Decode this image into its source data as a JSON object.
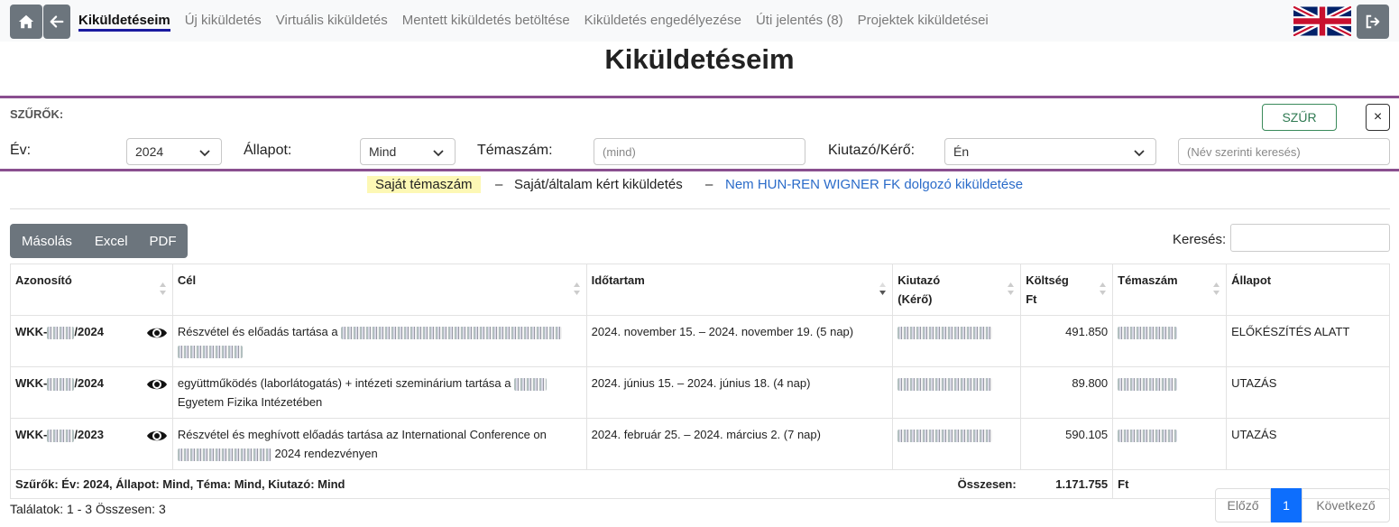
{
  "nav": {
    "links": [
      {
        "label": "Kiküldetéseim",
        "active": true
      },
      {
        "label": "Új kiküldetés"
      },
      {
        "label": "Virtuális kiküldetés"
      },
      {
        "label": "Mentett kiküldetés betöltése"
      },
      {
        "label": "Kiküldetés engedélyezése"
      },
      {
        "label": "Úti jelentés (8)"
      },
      {
        "label": "Projektek kiküldetései"
      }
    ]
  },
  "page": {
    "title": "Kiküldetéseim"
  },
  "filters": {
    "heading": "SZŰRŐK:",
    "apply_label": "SZŰR",
    "close_label": "×",
    "year_label": "Év:",
    "year_value": "2024",
    "status_label": "Állapot:",
    "status_value": "Mind",
    "topic_label": "Témaszám:",
    "topic_placeholder": "(mind)",
    "traveler_label": "Kiutazó/Kérő:",
    "traveler_value": "Én",
    "name_placeholder": "(Név szerinti keresés)"
  },
  "legend": {
    "own_topic": "Saját témaszám",
    "dash": "–",
    "own_requested": "Saját/általam kért kiküldetés",
    "external": "Nem HUN-REN WIGNER FK dolgozó kiküldetése"
  },
  "toolbar": {
    "copy": "Másolás",
    "excel": "Excel",
    "pdf": "PDF",
    "search_label": "Keresés:"
  },
  "table": {
    "headers": {
      "id": "Azonosító",
      "goal": "Cél",
      "duration": "Időtartam",
      "traveler": "Kiutazó",
      "traveler2": "(Kérő)",
      "cost": "Költség",
      "cost2": "Ft",
      "topic": "Témaszám",
      "status": "Állapot"
    },
    "rows": [
      {
        "id_prefix": "WKK-",
        "id_suffix": "/2024",
        "goal": "Részvétel és előadás tartása a",
        "goal2": "",
        "duration": "2024. november 15. – 2024. november 19. (5 nap)",
        "cost": "491.850",
        "status": "ELŐKÉSZÍTÉS ALATT"
      },
      {
        "id_prefix": "WKK-",
        "id_suffix": "/2024",
        "goal": "együttműködés (laborlátogatás) + intézeti szeminárium tartása a",
        "goal2": "Egyetem Fizika Intézetében",
        "duration": "2024. június 15. – 2024. június 18. (4 nap)",
        "cost": "89.800",
        "status": "UTAZÁS"
      },
      {
        "id_prefix": "WKK-",
        "id_suffix": "/2023",
        "goal": "Részvétel és meghívott előadás tartása az International Conference on",
        "goal2": "2024 rendezvényen",
        "duration": "2024. február 25. – 2024. március 2. (7 nap)",
        "cost": "590.105",
        "status": "UTAZÁS"
      }
    ],
    "footer": {
      "filters_label": "Szűrők:",
      "filters_value": "Év: 2024, Állapot: Mind, Téma: Mind, Kiutazó: Mind",
      "total_label": "Összesen:",
      "total_value": "1.171.755",
      "currency": "Ft"
    }
  },
  "pagination": {
    "results": "Találatok: 1 - 3 Összesen: 3",
    "prev": "Előző",
    "current": "1",
    "next": "Következő"
  },
  "colors": {
    "accent": "#8a4f8f",
    "button_gray": "#6c757d",
    "primary": "#0d6efd",
    "highlight": "#fdf8b5",
    "link": "#2a6bc9"
  }
}
